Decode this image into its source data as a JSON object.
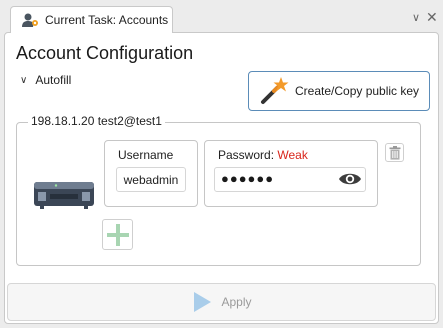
{
  "tab": {
    "title": "Current Task: Accounts"
  },
  "window_controls": {
    "collapse_glyph": "∨",
    "close_glyph": "✕"
  },
  "heading": "Account Configuration",
  "autofill": {
    "label": "Autofill",
    "chevron": "∨"
  },
  "create_key_button": {
    "label": "Create/Copy public key",
    "icon": "magic-wand-icon"
  },
  "account_group": {
    "label": "198.18.1.20 test2@test1",
    "username": {
      "label": "Username",
      "value": "webadmin"
    },
    "password": {
      "label": "Password:",
      "strength": "Weak",
      "masked_value": "●●●●●●",
      "strength_color": "#d9261c"
    }
  },
  "apply_button": {
    "label": "Apply"
  },
  "colors": {
    "accent": "#5b8cb8",
    "play_icon": "#a9cdea",
    "add_icon": "#a8d5b2"
  }
}
